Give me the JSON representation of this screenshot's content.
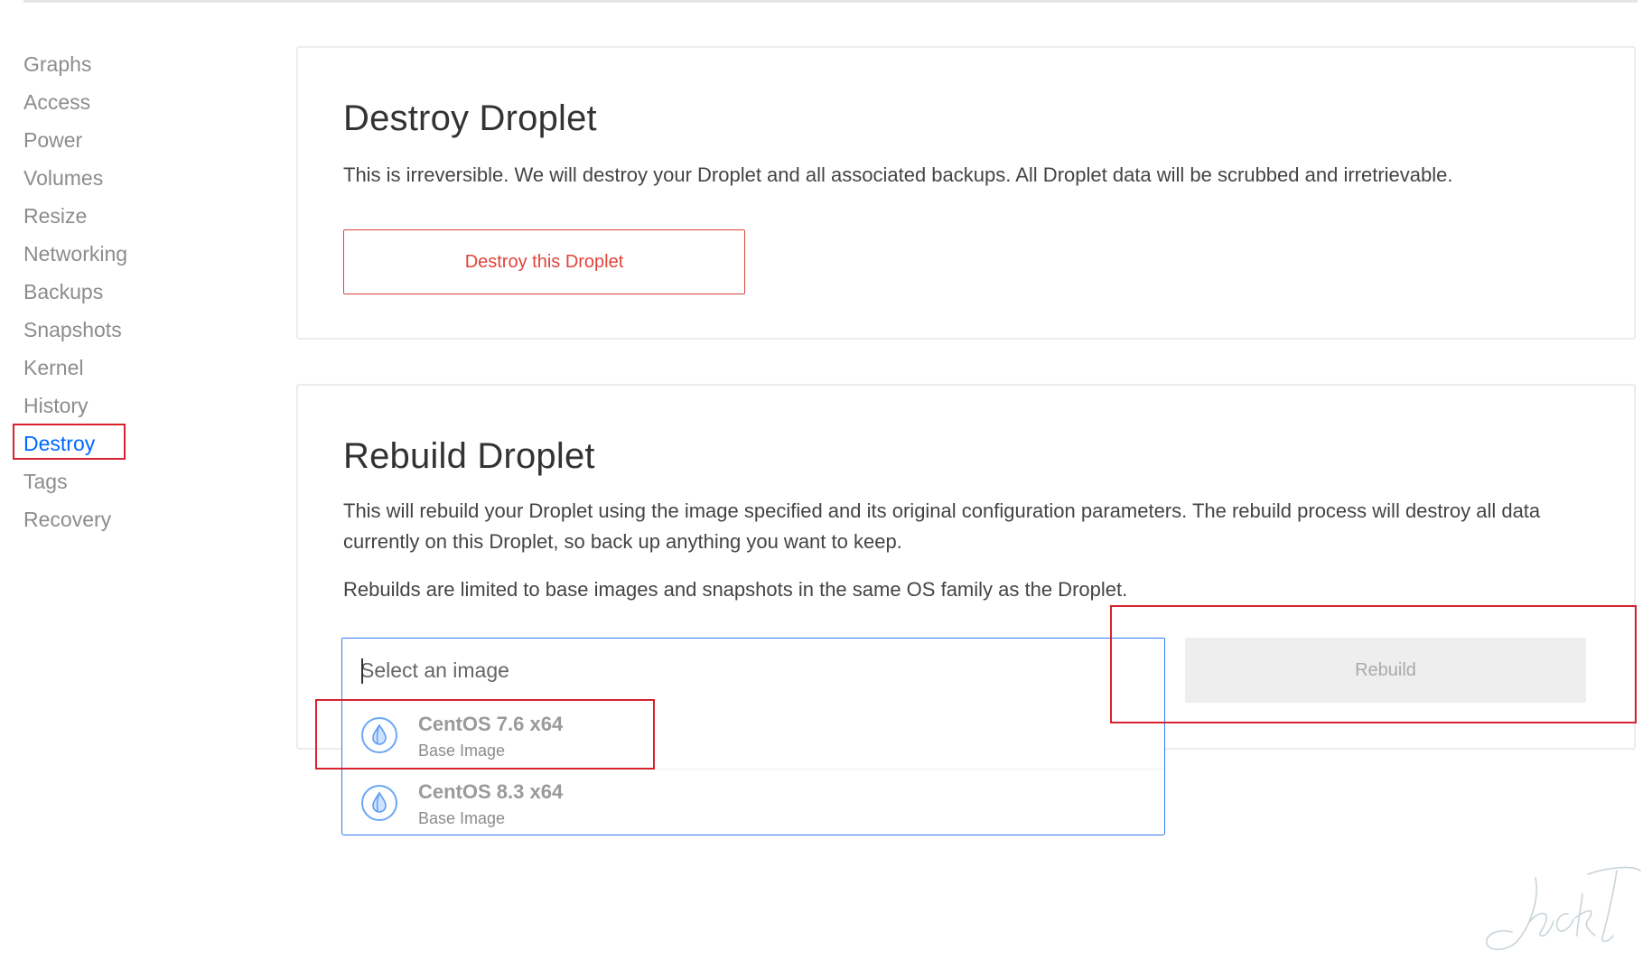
{
  "sidebar": {
    "items": [
      {
        "label": "Graphs"
      },
      {
        "label": "Access"
      },
      {
        "label": "Power"
      },
      {
        "label": "Volumes"
      },
      {
        "label": "Resize"
      },
      {
        "label": "Networking"
      },
      {
        "label": "Backups"
      },
      {
        "label": "Snapshots"
      },
      {
        "label": "Kernel"
      },
      {
        "label": "History"
      },
      {
        "label": "Destroy",
        "active": true
      },
      {
        "label": "Tags"
      },
      {
        "label": "Recovery"
      }
    ]
  },
  "destroy": {
    "title": "Destroy Droplet",
    "description": "This is irreversible. We will destroy your Droplet and all associated backups. All Droplet data will be scrubbed and irretrievable.",
    "button_label": "Destroy this Droplet"
  },
  "rebuild": {
    "title": "Rebuild Droplet",
    "description": "This will rebuild your Droplet using the image specified and its original configuration parameters. The rebuild process will destroy all data currently on this Droplet, so back up anything you want to keep.",
    "note": "Rebuilds are limited to base images and snapshots in the same OS family as the Droplet.",
    "select_placeholder": "Select an image",
    "select_value": "",
    "options": [
      {
        "name": "CentOS 7.6 x64",
        "sub": "Base Image",
        "icon": "centos-droplet-icon"
      },
      {
        "name": "CentOS 8.3 x64",
        "sub": "Base Image",
        "icon": "centos-droplet-icon"
      }
    ],
    "button_label": "Rebuild",
    "button_disabled": true
  },
  "colors": {
    "accent": "#0069ff",
    "danger": "#e0433c",
    "annotation": "#d6232f",
    "muted_text": "#8c8c8c"
  },
  "watermark": {
    "text": "JackT"
  }
}
